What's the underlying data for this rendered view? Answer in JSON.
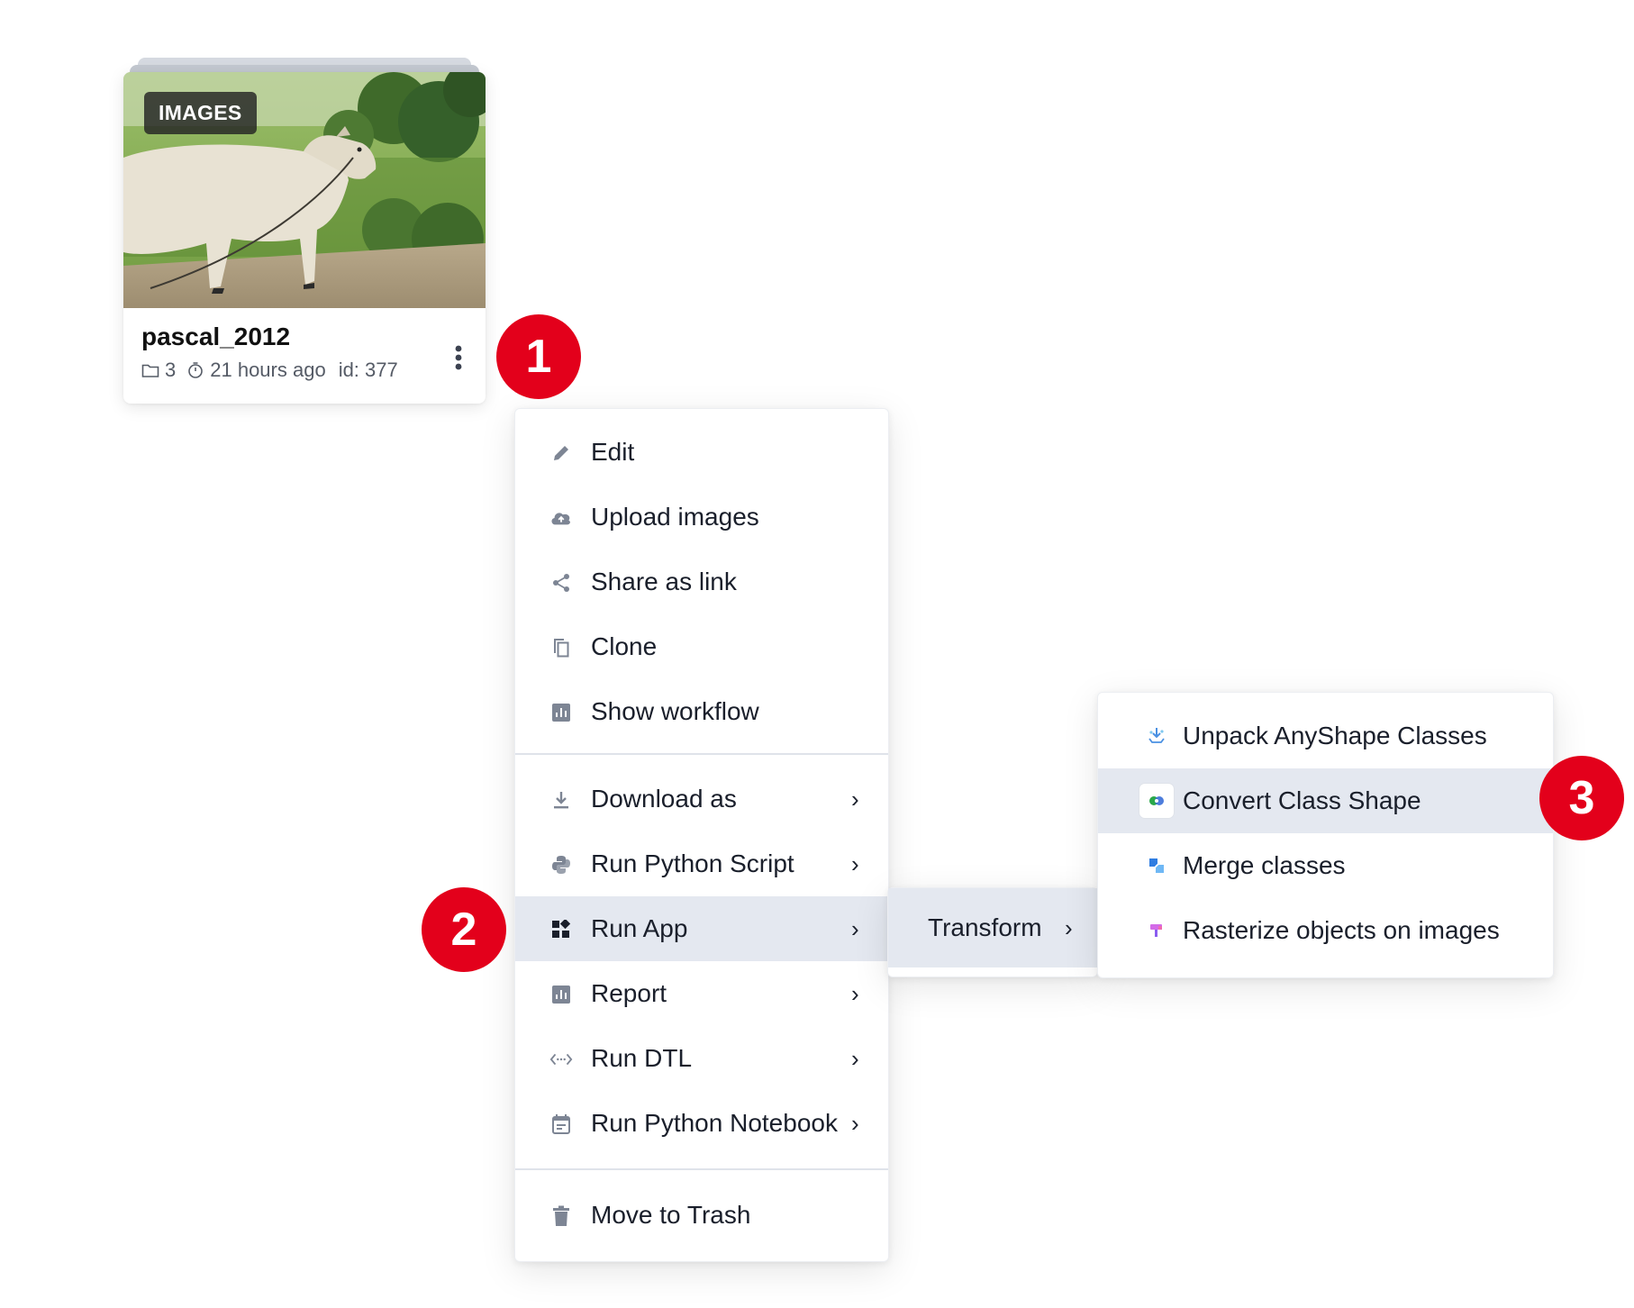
{
  "card": {
    "badge": "IMAGES",
    "title": "pascal_2012",
    "folder_count": "3",
    "time_ago": "21 hours ago",
    "id_label": "id: 377"
  },
  "callouts": [
    "1",
    "2",
    "3"
  ],
  "context_menu": {
    "items": [
      {
        "label": "Edit",
        "icon": "pencil-icon"
      },
      {
        "label": "Upload images",
        "icon": "cloud-upload-icon"
      },
      {
        "label": "Share as link",
        "icon": "share-icon"
      },
      {
        "label": "Clone",
        "icon": "copy-icon"
      },
      {
        "label": "Show workflow",
        "icon": "chart-icon"
      },
      {
        "label": "Download as",
        "icon": "download-icon",
        "submenu": true
      },
      {
        "label": "Run Python Script",
        "icon": "python-icon",
        "submenu": true
      },
      {
        "label": "Run App",
        "icon": "apps-icon",
        "submenu": true,
        "active": true
      },
      {
        "label": "Report",
        "icon": "report-icon",
        "submenu": true
      },
      {
        "label": "Run DTL",
        "icon": "code-icon",
        "submenu": true
      },
      {
        "label": "Run Python Notebook",
        "icon": "notebook-icon",
        "submenu": true
      },
      {
        "label": "Move to Trash",
        "icon": "trash-icon"
      }
    ]
  },
  "run_app_submenu": {
    "items": [
      {
        "label": "Transform",
        "submenu": true,
        "active": true
      }
    ]
  },
  "transform_apps": {
    "items": [
      {
        "label": "Unpack AnyShape Classes",
        "icon": "unpack-icon"
      },
      {
        "label": "Convert Class Shape",
        "icon": "convert-shape-icon",
        "active": true
      },
      {
        "label": "Merge classes",
        "icon": "merge-icon"
      },
      {
        "label": "Rasterize objects on images",
        "icon": "rasterize-icon"
      }
    ]
  },
  "chevron": "›",
  "colors": {
    "callout": "#e3001b",
    "active_row": "#e4e8f0",
    "icon_gray": "#7d8594"
  }
}
